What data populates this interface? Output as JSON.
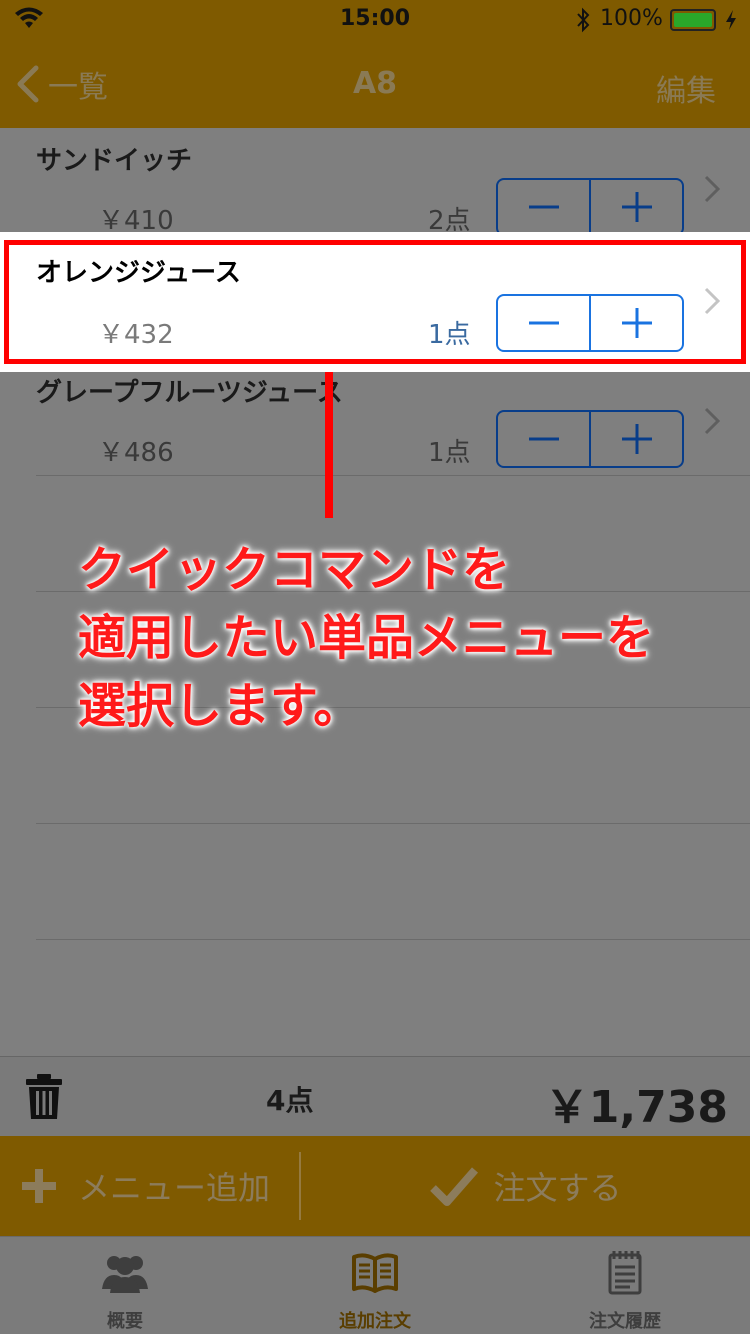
{
  "status_bar": {
    "time": "15:00",
    "battery": "100%"
  },
  "nav": {
    "back_label": "一覧",
    "title": "A8",
    "edit_label": "編集"
  },
  "items": [
    {
      "name": "サンドイッチ",
      "price": "￥410",
      "qty": "2点"
    },
    {
      "name": "オレンジジュース",
      "price": "￥432",
      "qty": "1点"
    },
    {
      "name": "グレープフルーツジュース",
      "price": "￥486",
      "qty": "1点"
    }
  ],
  "callout": {
    "line1": "クイックコマンドを",
    "line2": "適用したい単品メニューを",
    "line3": "選択します。"
  },
  "summary": {
    "count": "4点",
    "total": "￥1,738"
  },
  "actions": {
    "add_menu": "メニュー追加",
    "order": "注文する"
  },
  "tabs": [
    {
      "label": "概要",
      "icon": "people-icon"
    },
    {
      "label": "追加注文",
      "icon": "book-icon"
    },
    {
      "label": "注文履歴",
      "icon": "notepad-icon"
    }
  ],
  "colors": {
    "accent": "#ffb400",
    "highlight": "#ff0000",
    "stepper": "#1a73e0"
  }
}
